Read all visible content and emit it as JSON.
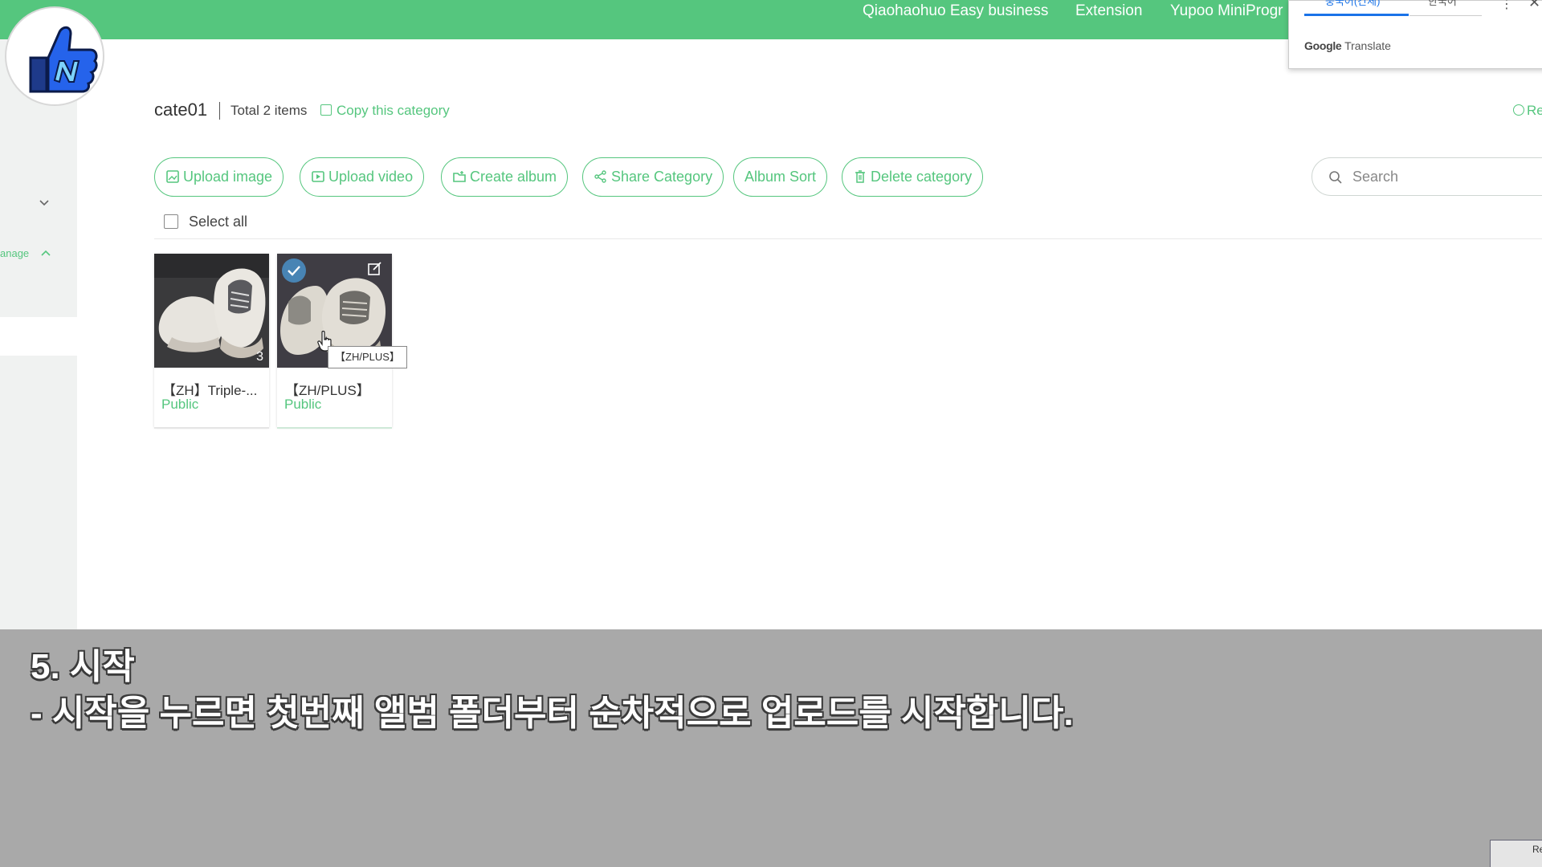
{
  "topnav": [
    "Qiaohaohuo Easy business",
    "Extension",
    "Yupoo MiniProgr"
  ],
  "translate": {
    "tab_source": "중국어(간체)",
    "tab_target": "한국어",
    "brand_google": "Google",
    "brand_translate": "Translate"
  },
  "sidebar": {
    "item_label": "anage"
  },
  "header": {
    "category": "cate01",
    "total": "Total 2 items",
    "copy": "Copy this category",
    "right_link": "Re"
  },
  "actions": {
    "upload_image": "Upload image",
    "upload_video": "Upload video",
    "create_album": "Create album",
    "share_category": "Share Category",
    "album_sort": "Album Sort",
    "delete_category": "Delete category"
  },
  "search": {
    "placeholder": "Search"
  },
  "select_all": "Select all",
  "albums": [
    {
      "title": "【ZH】Triple-...",
      "status": "Public",
      "count": "3"
    },
    {
      "title": "【ZH/PLUS】",
      "status": "Public",
      "tooltip": "【ZH/PLUS】"
    }
  ],
  "subtitle": {
    "line1": "5. 시작",
    "line2": "- 시작을 누르면 첫번째 앨범 폴더부터 순차적으로 업로드를 시작합니다."
  },
  "corner_text": "Re",
  "colors": {
    "accent": "#55c67e",
    "google_blue": "#1a73e8"
  },
  "icons": [
    "thumbs-up-logo-icon",
    "chevron-down-icon",
    "chevron-up-icon",
    "copy-icon",
    "upload-image-icon",
    "upload-video-icon",
    "create-album-icon",
    "share-icon",
    "trash-icon",
    "search-icon",
    "checkmark-icon",
    "edit-icon",
    "cursor-icon"
  ]
}
